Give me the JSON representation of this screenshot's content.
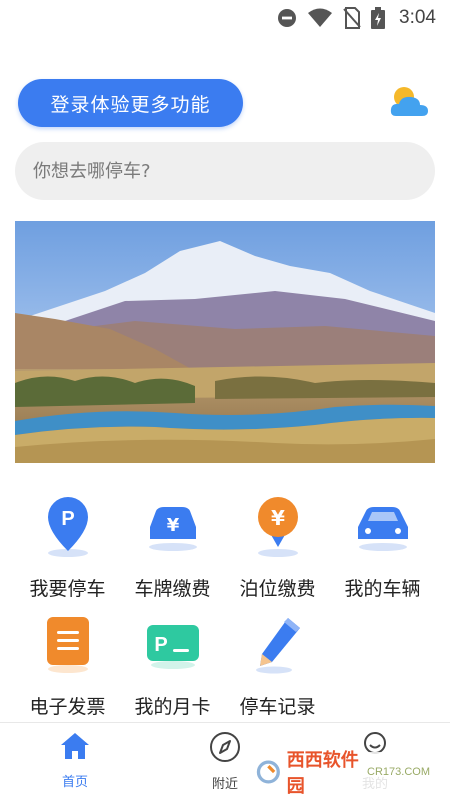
{
  "status_bar": {
    "time": "3:04",
    "icons": [
      "do-not-disturb-icon",
      "wifi-icon",
      "no-sim-icon",
      "battery-charging-icon"
    ]
  },
  "header": {
    "login_label": "登录体验更多功能",
    "weather_icon": "cloud-sun-icon"
  },
  "search": {
    "placeholder": "你想去哪停车?"
  },
  "banner": {
    "image_icon": "mountain-river-landscape"
  },
  "features": [
    {
      "label": "我要停车",
      "icon": "parking-pin-icon"
    },
    {
      "label": "车牌缴费",
      "icon": "car-yuan-icon"
    },
    {
      "label": "泊位缴费",
      "icon": "yuan-pin-icon"
    },
    {
      "label": "我的车辆",
      "icon": "car-icon"
    },
    {
      "label": "电子发票",
      "icon": "invoice-icon"
    },
    {
      "label": "我的月卡",
      "icon": "parking-card-icon"
    },
    {
      "label": "停车记录",
      "icon": "pen-record-icon"
    }
  ],
  "tabbar": {
    "tabs": [
      {
        "label": "首页",
        "icon": "home-icon",
        "active": true
      },
      {
        "label": "附近",
        "icon": "compass-icon",
        "active": false
      },
      {
        "label": "我的",
        "icon": "user-icon",
        "active": false
      }
    ]
  },
  "watermark": {
    "text": "西西软件园",
    "sub": "CR173.COM"
  },
  "colors": {
    "accent": "#3b7cf0",
    "orange": "#f08a2c",
    "green": "#2ec9a0"
  }
}
